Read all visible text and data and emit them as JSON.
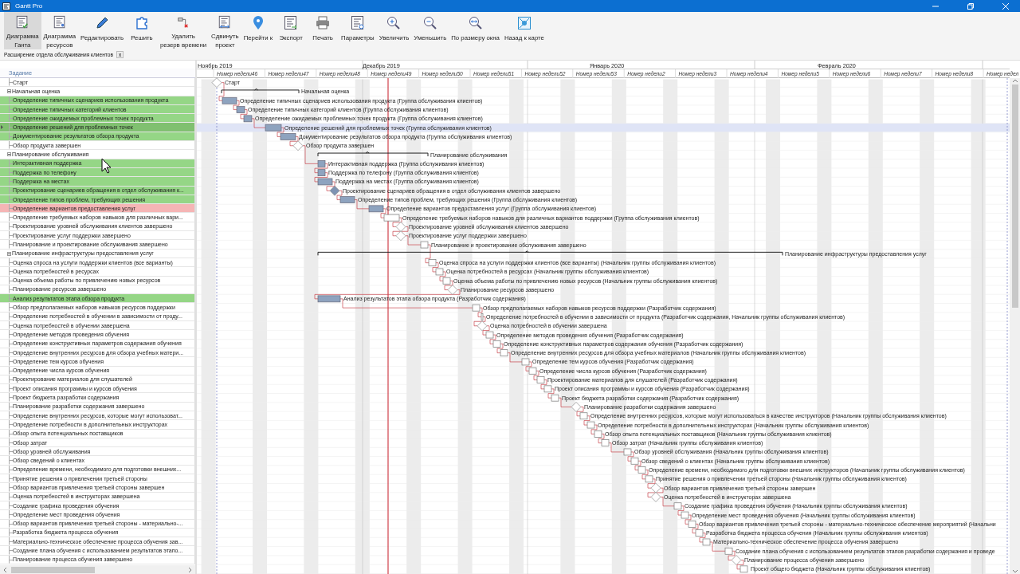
{
  "window": {
    "title": "Gantt Pro"
  },
  "toolbar": [
    {
      "lines": [
        "Диаграмма",
        "Ганта"
      ],
      "selected": true
    },
    {
      "lines": [
        "Диаграмма",
        "ресурсов"
      ],
      "selected": false
    },
    {
      "lines": [
        "Редактировать"
      ],
      "selected": false
    },
    {
      "lines": [
        "Решить"
      ],
      "selected": false
    },
    {
      "lines": [
        "Удалить",
        "резерв времени"
      ],
      "selected": false
    },
    {
      "lines": [
        "Сдвинуть",
        "проект"
      ],
      "selected": false
    },
    {
      "lines": [
        "Перейти к"
      ],
      "selected": false
    },
    {
      "lines": [
        "Экспорт"
      ],
      "selected": false
    },
    {
      "lines": [
        "Печать"
      ],
      "selected": false
    },
    {
      "lines": [
        "Параметры"
      ],
      "selected": false
    },
    {
      "lines": [
        "Увеличить"
      ],
      "selected": false
    },
    {
      "lines": [
        "Уменьшить"
      ],
      "selected": false
    },
    {
      "lines": [
        "По размеру окна"
      ],
      "selected": false
    },
    {
      "lines": [
        "Назад к карте"
      ],
      "selected": false
    }
  ],
  "document_tab": {
    "label": "Расширение отдела обслуживания клиентов",
    "close": "x"
  },
  "timeline": {
    "months": [
      "Ноябрь 2019",
      "Декабрь 2019",
      "Январь 2020",
      "Февраль 2020"
    ],
    "weeks": [
      "Номер недели46",
      "Номер недели47",
      "Номер недели48",
      "Номер недели49",
      "Номер недели50",
      "Номер недели51",
      "Номер недели52",
      "Номер недели53",
      "Номер недели2",
      "Номер недели3",
      "Номер недели4",
      "Номер недели5",
      "Номер недели6",
      "Номер недели7",
      "Номер недели8",
      "Номер недел"
    ]
  },
  "task_column": "Задание",
  "tasks": [
    {
      "name": "Старт",
      "kind": "milestone",
      "selected": false,
      "complete": false,
      "bar_label": "Старт"
    },
    {
      "name": "Начальная оценка",
      "kind": "summary",
      "selected": false,
      "expanded": true,
      "bar_label": "Начальная оценка"
    },
    {
      "name": "Определение типичных сценариев использования продукта",
      "kind": "task",
      "color": "#95d686",
      "selected": false,
      "complete": true,
      "bar_label": "Определение типичных сценариев использования продукта (Группа обслуживания клиентов)"
    },
    {
      "name": "Определение типичных категорий клиентов",
      "kind": "task",
      "color": "#95d686",
      "selected": false,
      "complete": true,
      "bar_label": "Определение типичных категорий клиентов (Группа обслуживания клиентов)"
    },
    {
      "name": "Определение ожидаемых проблемных точек продукта",
      "kind": "task",
      "color": "#95d686",
      "selected": false,
      "complete": true,
      "bar_label": "Определение ожидаемых проблемных точек продукта (Группа обслуживания клиентов)"
    },
    {
      "name": "Определение решений для проблемных точек",
      "kind": "task",
      "color": "#80c070",
      "selected": true,
      "complete": true,
      "bar_label": "Определение решений для проблемных точек (Группа обслуживания клиентов)"
    },
    {
      "name": "Документирование результатов обзора продукта",
      "kind": "task",
      "color": "#95d686",
      "selected": false,
      "complete": true,
      "bar_label": "Документирование результатов обзора продукта (Группа обслуживания клиентов)"
    },
    {
      "name": "Обзор продукта завершен",
      "kind": "milestone",
      "selected": false,
      "complete": false,
      "bar_label": "Обзор продукта завершен"
    },
    {
      "name": "Планирование обслуживания",
      "kind": "summary",
      "selected": false,
      "expanded": true,
      "bar_label": "Планирование обслуживания"
    },
    {
      "name": "Интерактивная поддержка",
      "kind": "task",
      "color": "#95d686",
      "selected": false,
      "complete": true,
      "bar_label": "Интерактивная поддержка (Группа обслуживания клиентов)"
    },
    {
      "name": "Поддержка по телефону",
      "kind": "task",
      "color": "#95d686",
      "selected": false,
      "complete": true,
      "bar_label": "Поддержка по телефону (Группа обслуживания клиентов)"
    },
    {
      "name": "Поддержка на местах",
      "kind": "task",
      "color": "#95d686",
      "selected": false,
      "complete": true,
      "bar_label": "Поддержка на местах (Группа обслуживания клиентов)"
    },
    {
      "name": "Проектирование сценариев обращения в отдел обслуживания к...",
      "kind": "milestone",
      "color": "#95d686",
      "selected": false,
      "complete": true,
      "bar_label": "Проектирование сценариев обращения в отдел обслуживания клиентов завершено"
    },
    {
      "name": "Определение типов проблем, требующих решения",
      "kind": "task",
      "color": "#95d686",
      "selected": false,
      "complete": true,
      "bar_label": "Определение типов проблем, требующих решения (Группа обслуживания клиентов)"
    },
    {
      "name": "Определение вариантов предоставления услуг",
      "kind": "task",
      "color": "#f5b5b5",
      "selected": false,
      "complete": true,
      "bar_label": "Определение вариантов предоставления услуг (Группа обслуживания клиентов)"
    },
    {
      "name": "Определение требуемых наборов навыков для различных вари...",
      "kind": "task",
      "selected": false,
      "complete": false,
      "bar_label": "Определение требуемых наборов навыков для различных вариантов поддержки (Группа обслуживания клиентов)"
    },
    {
      "name": "Проектирование уровней обслуживания клиентов завершено",
      "kind": "milestone",
      "selected": false,
      "complete": false,
      "bar_label": "Проектирование уровней обслуживания клиентов завершено"
    },
    {
      "name": "Проектирование услуг поддержки завершено",
      "kind": "milestone",
      "selected": false,
      "complete": false,
      "bar_label": "Проектирование услуг поддержки завершено"
    },
    {
      "name": "Планирование и проектирование обслуживания завершено",
      "kind": "task",
      "selected": false,
      "complete": false,
      "bar_label": "Планирование и проектирование обслуживания завершено"
    },
    {
      "name": "Планирование инфраструктуры предоставления услуг",
      "kind": "summary",
      "selected": false,
      "expanded": true,
      "bar_label": "Планирование инфраструктуры предоставления услуг"
    },
    {
      "name": "Оценка спроса на услуги поддержки клиентов (все варианты)",
      "kind": "task",
      "selected": false,
      "complete": false,
      "bar_label": "Оценка спроса на услуги поддержки клиентов (все варианты) (Начальник группы обслуживания клиентов)"
    },
    {
      "name": "Оценка потребностей в ресурсах",
      "kind": "task",
      "selected": false,
      "complete": false,
      "bar_label": "Оценка потребностей в ресурсах (Начальник группы обслуживания клиентов)"
    },
    {
      "name": "Оценка объема работы по привлечению новых ресурсов",
      "kind": "task",
      "selected": false,
      "complete": false,
      "bar_label": "Оценка объема работы по привлечению новых ресурсов (Начальник группы обслуживания клиентов)"
    },
    {
      "name": "Планирование ресурсов завершено",
      "kind": "milestone",
      "selected": false,
      "complete": false,
      "bar_label": "Планирование ресурсов завершено"
    },
    {
      "name": "Анализ результатов этапа обзора продукта",
      "kind": "task",
      "color": "#95d686",
      "selected": false,
      "complete": true,
      "bar_label": "Анализ результатов этапа обзора продукта (Разработчик содержания)"
    },
    {
      "name": "Обзор предполагаемых наборов навыков ресурсов поддержки",
      "kind": "task",
      "selected": false,
      "complete": false,
      "bar_label": "Обзор предполагаемых наборов навыков ресурсов поддержки (Разработчик содержания)"
    },
    {
      "name": "Определение потребностей в обучении в зависимости от проду...",
      "kind": "task",
      "selected": false,
      "complete": false,
      "bar_label": "Определение потребностей в обучении в зависимости от продукта (Разработчик содержания, Начальник группы обслуживания клиентов)"
    },
    {
      "name": "Оценка потребностей в обучении завершена",
      "kind": "milestone",
      "selected": false,
      "complete": false,
      "bar_label": "Оценка потребностей в обучении завершена"
    },
    {
      "name": "Определение методов проведения обучения",
      "kind": "task",
      "selected": false,
      "complete": false,
      "bar_label": "Определение методов проведения обучения (Разработчик содержания)"
    },
    {
      "name": "Определение конструктивных параметров содержания обучения",
      "kind": "task",
      "selected": false,
      "complete": false,
      "bar_label": "Определение конструктивных параметров содержания обучения (Разработчик содержания)"
    },
    {
      "name": "Определение внутренних ресурсов для обзора учебных матери...",
      "kind": "task",
      "selected": false,
      "complete": false,
      "bar_label": "Определение внутренних ресурсов для обзора учебных материалов (Начальник группы обслуживания клиентов)"
    },
    {
      "name": "Определение тем курсов обучения",
      "kind": "task",
      "selected": false,
      "complete": false,
      "bar_label": "Определение тем курсов обучения (Разработчик содержания)"
    },
    {
      "name": "Определение числа курсов обучения",
      "kind": "task",
      "selected": false,
      "complete": false,
      "bar_label": "Определение числа курсов обучения (Разработчик содержания)"
    },
    {
      "name": "Проектирование материалов для слушателей",
      "kind": "task",
      "selected": false,
      "complete": false,
      "bar_label": "Проектирование материалов для слушателей (Разработчик содержания)"
    },
    {
      "name": "Проект описания программы и курсов обучения",
      "kind": "task",
      "selected": false,
      "complete": false,
      "bar_label": "Проект описания программы и курсов обучения (Разработчик содержания)"
    },
    {
      "name": "Проект бюджета разработки содержания",
      "kind": "task",
      "selected": false,
      "complete": false,
      "bar_label": "Проект бюджета разработки содержания (Разработчик содержания)"
    },
    {
      "name": "Планирование разработки содержания завершено",
      "kind": "milestone",
      "selected": false,
      "complete": false,
      "bar_label": "Планирование разработки содержания завершено"
    },
    {
      "name": "Определение внутренних ресурсов, которые могут использоват...",
      "kind": "task",
      "selected": false,
      "complete": false,
      "bar_label": "Определение внутренних ресурсов, которые могут использоваться в качестве инструкторов (Начальник группы обслуживания клиентов)"
    },
    {
      "name": "Определение потребности в дополнительных инструкторах",
      "kind": "task",
      "selected": false,
      "complete": false,
      "bar_label": "Определение потребности в дополнительных инструкторах (Начальник группы обслуживания клиентов)"
    },
    {
      "name": "Обзор опыта потенциальных поставщиков",
      "kind": "task",
      "selected": false,
      "complete": false,
      "bar_label": "Обзор опыта потенциальных поставщиков (Начальник группы обслуживания клиентов)"
    },
    {
      "name": "Обзор затрат",
      "kind": "task",
      "selected": false,
      "complete": false,
      "bar_label": "Обзор затрат (Начальник группы обслуживания клиентов)"
    },
    {
      "name": "Обзор уровней обслуживания",
      "kind": "task",
      "selected": false,
      "complete": false,
      "bar_label": "Обзор уровней обслуживания (Начальник группы обслуживания клиентов)"
    },
    {
      "name": "Обзор сведений о клиентах",
      "kind": "task",
      "selected": false,
      "complete": false,
      "bar_label": "Обзор сведений о клиентах (Начальник группы обслуживания клиентов)"
    },
    {
      "name": "Определение времени, необходимого для подготовки внешних...",
      "kind": "task",
      "selected": false,
      "complete": false,
      "bar_label": "Определение времени, необходимого для подготовки внешних инструкторов (Начальник группы обслуживания клиентов)"
    },
    {
      "name": "Принятие решения о привлечении третьей стороны",
      "kind": "task",
      "selected": false,
      "complete": false,
      "bar_label": "Принятие решения о привлечении третьей стороны (Начальник группы обслуживания клиентов)"
    },
    {
      "name": "Обзор вариантов привлечения третьей стороны завершен",
      "kind": "milestone",
      "selected": false,
      "complete": false,
      "bar_label": "Обзор вариантов привлечения третьей стороны завершен"
    },
    {
      "name": "Оценка потребностей в инструкторах завершена",
      "kind": "milestone",
      "selected": false,
      "complete": false,
      "bar_label": "Оценка потребностей в инструкторах завершена"
    },
    {
      "name": "Создание графика проведения обучения",
      "kind": "task",
      "selected": false,
      "complete": false,
      "bar_label": "Создание графика проведения обучения (Начальник группы обслуживания клиентов)"
    },
    {
      "name": "Определение мест проведения обучения",
      "kind": "task",
      "selected": false,
      "complete": false,
      "bar_label": "Определение мест проведения обучения (Начальник группы обслуживания клиентов)"
    },
    {
      "name": "Обзор вариантов привлечения третьей стороны - материально-...",
      "kind": "task",
      "selected": false,
      "complete": false,
      "bar_label": "Обзор вариантов привлечения третьей стороны - материально-техническое обеспечение мероприятий (Начальни"
    },
    {
      "name": "Разработка бюджета процесса обучения",
      "kind": "task",
      "selected": false,
      "complete": false,
      "bar_label": "Разработка бюджета процесса обучения (Начальник группы обслуживания клиентов)"
    },
    {
      "name": "Материально-техническое обеспечение процесса обучения зав...",
      "kind": "task",
      "selected": false,
      "complete": false,
      "bar_label": "Материально-техническое обеспечение процесса обучения завершено"
    },
    {
      "name": "Создание плана обучения с использованием результатов этапо...",
      "kind": "task",
      "selected": false,
      "complete": false,
      "bar_label": "Создание плана обучения с использованием результатов этапов разработки содержания и проведе"
    },
    {
      "name": "Планирование процесса обучения завершено",
      "kind": "milestone",
      "selected": false,
      "complete": false,
      "bar_label": "Планирование процесса обучения завершено"
    },
    {
      "kind": "task",
      "selected": false,
      "complete": false,
      "bar_label": "Проект общего бюджета (Начальник группы обслуживания клиентов)"
    }
  ]
}
